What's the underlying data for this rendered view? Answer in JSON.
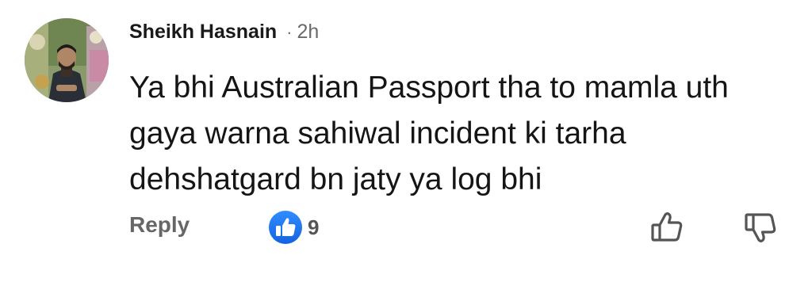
{
  "comment": {
    "author": "Sheikh Hasnain",
    "separator": "·",
    "timestamp": "2h",
    "text_lines": [
      "Ya bhi Australian Passport tha to mamla uth",
      "gaya warna sahiwal incident ki tarha",
      "dehshatgard bn jaty ya log bhi"
    ]
  },
  "actions": {
    "reply_label": "Reply",
    "reaction_count": "9",
    "reaction_icon": "thumbs-up-badge-icon",
    "like_icon": "thumbs-up-outline-icon",
    "dislike_icon": "thumbs-down-outline-icon"
  },
  "colors": {
    "reaction_blue": "#1877f2",
    "muted_text": "#666666"
  }
}
